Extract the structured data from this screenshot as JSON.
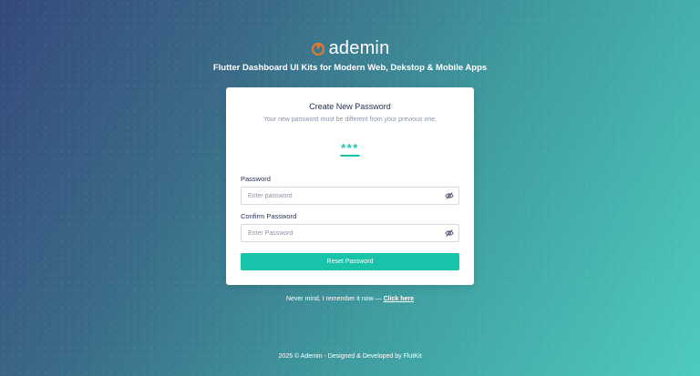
{
  "brand": {
    "name": "ademin",
    "logo_icon": "flame-logo-icon",
    "tagline": "Flutter Dashboard UI Kits for Modern Web, Dekstop & Mobile Apps"
  },
  "card": {
    "title": "Create New Password",
    "subtitle": "Your new password must be different from your previous one.",
    "decoration": "***",
    "password": {
      "label": "Password",
      "placeholder": "Enter password",
      "toggle_icon": "eye-off-icon"
    },
    "confirm_password": {
      "label": "Confirm Password",
      "placeholder": "Enter Password",
      "toggle_icon": "eye-off-icon"
    },
    "submit_label": "Reset Password"
  },
  "remember": {
    "text": "Never mind, I remember it now — ",
    "link_label": "Click here"
  },
  "footer": {
    "text": "2025 © Ademin - Designed & Developed by FlutKit"
  },
  "colors": {
    "accent": "#19c3a9",
    "logo": "#e07a2e",
    "title": "#1f2d4d",
    "background_start": "#34497a",
    "background_end": "#4dcbbd"
  }
}
